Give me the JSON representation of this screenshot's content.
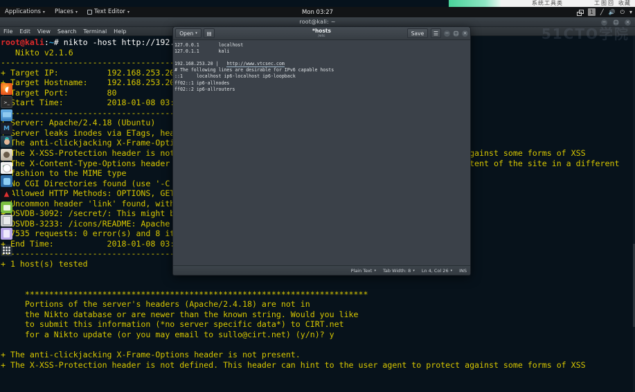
{
  "background_window": {
    "text_1": "系统工具类",
    "text_2": "工图回",
    "text_3": "收藏"
  },
  "top_panel": {
    "applications_label": "Applications",
    "places_label": "Places",
    "app_label": "Text Editor",
    "clock": "Mon 03:27",
    "workspace": "1",
    "caret": "▾",
    "tray": {
      "windows_icon": "windows-icon",
      "pencil_icon": "╱",
      "volume_icon": "🔊",
      "power_icon": "⏻",
      "menu_caret": "▾"
    }
  },
  "terminal": {
    "title": "root@kali: ~",
    "menu": [
      "File",
      "Edit",
      "View",
      "Search",
      "Terminal",
      "Help"
    ],
    "window_buttons": [
      "−",
      "□",
      "×"
    ],
    "lines": [
      {
        "type": "prompt",
        "user": "root",
        "at": "@",
        "host": "kali",
        "colon": ":",
        "path": "~",
        "hash": "# ",
        "cmd": "nikto -host http://192.168.253.20"
      },
      {
        "type": "plain",
        "text": "   Nikto v2.1.6"
      },
      {
        "type": "plain",
        "text": "---------------------------------------------------------------------------"
      },
      {
        "type": "plain",
        "text": "+ Target IP:          192.168.253.20"
      },
      {
        "type": "plain",
        "text": "+ Target Hostname:    192.168.253.20"
      },
      {
        "type": "plain",
        "text": "+ Target Port:        80"
      },
      {
        "type": "plain",
        "text": "+ Start Time:         2018-01-08 03:26:04 (GMT-5)"
      },
      {
        "type": "plain",
        "text": "---------------------------------------------------------------------------"
      },
      {
        "type": "plain",
        "text": "+ Server: Apache/2.4.18 (Ubuntu)"
      },
      {
        "type": "plain",
        "text": "+ Server leaks inodes via ETags, header found with file /, fields: 0x2cf8 0x55f"
      },
      {
        "type": "plain",
        "text": "+ The anti-clickjacking X-Frame-Options header is not present."
      },
      {
        "type": "plain",
        "text": "+ The X-XSS-Protection header is not defined. This header can hint to the user agent to protect against some forms of XSS"
      },
      {
        "type": "plain",
        "text": "+ The X-Content-Type-Options header is not set. This could allow the user agent to render the content of the site in a different"
      },
      {
        "type": "plain",
        "text": "  fashion to the MIME type"
      },
      {
        "type": "plain",
        "text": "+ No CGI Directories found (use '-C all' to force check all possible dirs)"
      },
      {
        "type": "plain",
        "text": "+ Allowed HTTP Methods: OPTIONS, GET, HEAD, POST"
      },
      {
        "type": "plain",
        "text": "+ Uncommon header 'link' found, with contents: <https://api.w.org/\""
      },
      {
        "type": "plain",
        "text": "+ OSVDB-3092: /secret/: This might be interesting..."
      },
      {
        "type": "plain",
        "text": "+ OSVDB-3233: /icons/README: Apache default file found."
      },
      {
        "type": "plain",
        "text": "+ 7535 requests: 0 error(s) and 8 item(s) reported on remote host"
      },
      {
        "type": "plain",
        "text": "+ End Time:           2018-01-08 03:27:10 (GMT-5) (66 seconds)"
      },
      {
        "type": "plain",
        "text": "---------------------------------------------------------------------------"
      },
      {
        "type": "plain",
        "text": "+ 1 host(s) tested"
      },
      {
        "type": "plain",
        "text": ""
      },
      {
        "type": "plain",
        "text": ""
      },
      {
        "type": "plain",
        "text": "     ***********************************************************************"
      },
      {
        "type": "plain",
        "text": "     Portions of the server's headers (Apache/2.4.18) are not in"
      },
      {
        "type": "plain",
        "text": "     the Nikto database or are newer than the known string. Would you like"
      },
      {
        "type": "plain",
        "text": "     to submit this information (*no server specific data*) to CIRT.net"
      },
      {
        "type": "plain",
        "text": "     for a Nikto update (or you may email to sullo@cirt.net) (y/n)? y"
      },
      {
        "type": "plain",
        "text": ""
      },
      {
        "type": "plain",
        "text": "+ The anti-clickjacking X-Frame-Options header is not present."
      },
      {
        "type": "plain",
        "text": "+ The X-XSS-Protection header is not defined. This header can hint to the user agent to protect against some forms of XSS"
      }
    ]
  },
  "dock": {
    "items": [
      {
        "name": "firefox-icon",
        "label": "Firefox"
      },
      {
        "name": "terminal-icon",
        "label": "Terminal"
      },
      {
        "name": "files-icon",
        "label": "Files"
      },
      {
        "name": "metasploit-icon",
        "label": "Metasploit"
      },
      {
        "name": "armitage-icon",
        "label": "Armitage"
      },
      {
        "name": "burpsuite-icon",
        "label": "Burp Suite"
      },
      {
        "name": "beef-icon",
        "label": "BeEF"
      },
      {
        "name": "faraday-icon",
        "label": "Faraday"
      },
      {
        "name": "maltego-icon",
        "label": "Maltego"
      },
      {
        "name": "notes-icon",
        "label": "Notes"
      },
      {
        "name": "calculator-icon",
        "label": "Calculator"
      },
      {
        "name": "document-icon",
        "label": "Documents"
      }
    ],
    "show_apps_label": "Show Applications"
  },
  "editor": {
    "open_label": "Open",
    "open_caret": "▾",
    "save_label": "Save",
    "hamburger_icon": "☰",
    "new_doc_icon": "▤",
    "title": "*hosts",
    "subtitle": "/etc",
    "window_buttons": [
      "−",
      "□",
      "×"
    ],
    "content_lines": [
      "127.0.0.1       localhost",
      "127.0.1.1       kali",
      "",
      "192.168.253.20 |   http://www.vtcsec.com",
      "# The following lines are desirable for IPv6 capable hosts",
      "::1     localhost ip6-localhost ip6-loopback",
      "ff02::1 ip6-allnodes",
      "ff02::2 ip6-allrouters"
    ],
    "status": {
      "syntax": "Plain Text",
      "tab_width": "Tab Width: 8",
      "position": "Ln 4, Col 26",
      "insert_mode": "INS",
      "caret": "▾"
    }
  },
  "watermark": "51CTO学院"
}
